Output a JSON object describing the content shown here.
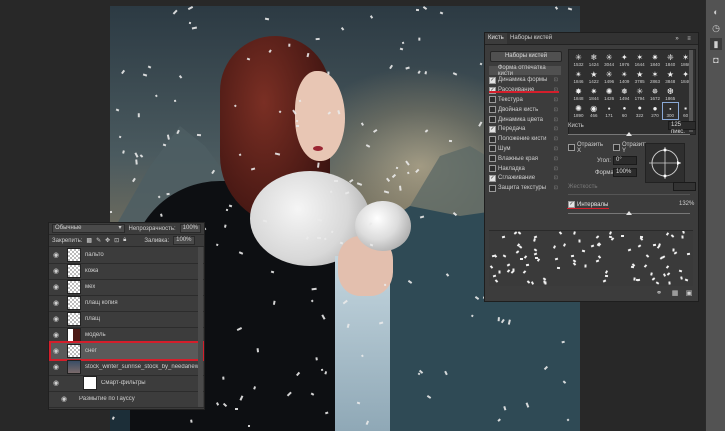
{
  "layers_panel": {
    "blend_mode": "Обычные",
    "opacity_label": "Непрозрачность:",
    "opacity_value": "100%",
    "lock_label": "Закрепить:",
    "fill_label": "Заливка:",
    "fill_value": "100%",
    "layers": [
      {
        "name": "пальто",
        "thumb": "transparent",
        "selected": false
      },
      {
        "name": "кожа",
        "thumb": "transparent",
        "selected": false
      },
      {
        "name": "мех",
        "thumb": "transparent",
        "selected": false
      },
      {
        "name": "плащ копия",
        "thumb": "transparent",
        "selected": false
      },
      {
        "name": "плащ",
        "thumb": "transparent",
        "selected": false
      },
      {
        "name": "модель",
        "thumb": "hair",
        "selected": false
      },
      {
        "name": "снег",
        "thumb": "transparent",
        "selected": true
      },
      {
        "name": "stock_winter_sunrise_stock_by_needanewname",
        "thumb": "photo",
        "selected": false
      },
      {
        "name": "Смарт-фильтры",
        "thumb": "white",
        "selected": false
      },
      {
        "name": "Размытие по Гауссу",
        "thumb": "none",
        "selected": false
      }
    ]
  },
  "brush_panel": {
    "tabs": [
      "Кисть",
      "Наборы кистей"
    ],
    "presets_button": "Наборы кистей",
    "options": [
      {
        "label": "Форма отпечатка кисти",
        "checked": null
      },
      {
        "label": "Динамика формы",
        "checked": true
      },
      {
        "label": "Рассеивание",
        "checked": true
      },
      {
        "label": "Текстура",
        "checked": false
      },
      {
        "label": "Двойная кисть",
        "checked": false
      },
      {
        "label": "Динамика цвета",
        "checked": false
      },
      {
        "label": "Передача",
        "checked": true
      },
      {
        "label": "Положение кисти",
        "checked": false
      },
      {
        "label": "Шум",
        "checked": false
      },
      {
        "label": "Влажные края",
        "checked": false
      },
      {
        "label": "Накладка",
        "checked": false
      },
      {
        "label": "Сглаживание",
        "checked": true
      },
      {
        "label": "Защита текстуры",
        "checked": false
      }
    ],
    "preset_sizes": [
      "1532",
      "1424",
      "3044",
      "1976",
      "1644",
      "1840",
      "1840",
      "1860",
      "1846",
      "1422",
      "1496",
      "1409",
      "3785",
      "2863",
      "3848",
      "1840",
      "1848",
      "1844",
      "1426",
      "1494",
      "1794",
      "1672",
      "1865",
      "",
      "1890",
      "466",
      "171",
      "60",
      "322",
      "270",
      "300",
      "60"
    ],
    "active_preset_index": 30,
    "size_label": "Кисть",
    "size_value": "125 пикс.",
    "flip_x": "Отразить X",
    "flip_y": "Отразить Y",
    "angle_label": "Угол:",
    "angle_value": "0°",
    "roundness_label": "Форма:",
    "roundness_value": "100%",
    "hardness_label": "Жесткость",
    "spacing_label": "Интервалы",
    "spacing_checked": true,
    "spacing_value": "132%",
    "spacing_fraction": 0.5,
    "size_fraction": 0.5
  },
  "icons": {
    "eye": "eye-icon",
    "lock": "lock-icon",
    "menu": "panel-menu-icon",
    "new_brush": "new-brush-icon",
    "grid": "grid-icon",
    "toggle": "toggle-brush-icon"
  },
  "colors": {
    "highlight_red": "#d41e2b",
    "panel_bg": "#3c3c3c"
  }
}
